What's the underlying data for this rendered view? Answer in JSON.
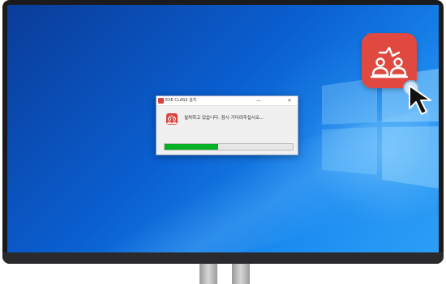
{
  "dialog": {
    "title": "EXE CLASS 설치",
    "minimize_label": "—",
    "close_label": "✕",
    "message": "설치하고 있습니다. 잠시 기다려주십시오...",
    "progress": 0.42
  },
  "icons": {
    "app": "classroom-people-icon",
    "shortcut": "classroom-people-icon",
    "cursor": "mouse-pointer-icon"
  },
  "colors": {
    "accent": "#e0493f",
    "progress": "#06b025",
    "desktop": "#0a5fd0"
  }
}
